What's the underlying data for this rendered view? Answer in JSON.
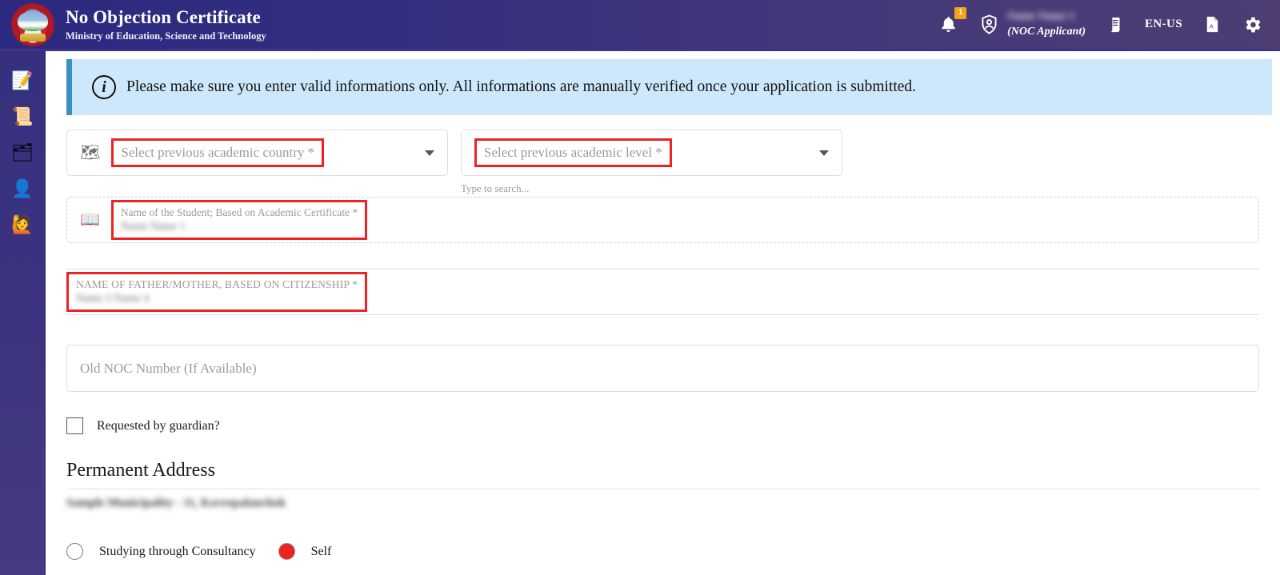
{
  "header": {
    "emblem_name": "nepal-government-emblem",
    "title": "No Objection Certificate",
    "subtitle": "Ministry of Education, Science and Technology",
    "notification_badge": "1",
    "user_name": "Name Name 1",
    "user_role": "(NOC Applicant)",
    "language": "EN-US",
    "icons": {
      "bell": "🔔",
      "shield_user": "⛨",
      "document": "📜",
      "pdf": "📑",
      "gear": "⚙"
    }
  },
  "sidebar": {
    "items": [
      {
        "name": "new-application",
        "icon": "📝"
      },
      {
        "name": "certificates",
        "icon": "📜"
      },
      {
        "name": "documents",
        "icon": "🗂"
      },
      {
        "name": "profile",
        "icon": "👤"
      },
      {
        "name": "help",
        "icon": "🙋"
      }
    ]
  },
  "alert": {
    "icon": "i",
    "message": "Please make sure you enter valid informations only. All informations are manually verified once your application is submitted."
  },
  "form": {
    "country": {
      "icon": "🗺",
      "placeholder": "Select previous academic country *"
    },
    "level": {
      "placeholder": "Select previous academic level *",
      "helper": "Type to search..."
    },
    "student_name": {
      "icon": "📖",
      "label": "Name of the Student; Based on Academic Certificate *",
      "value": "Name Name 1"
    },
    "parent_name": {
      "label": "NAME OF FATHER/MOTHER, BASED ON CITIZENSHIP *",
      "value": "Name 3 Name 4"
    },
    "old_noc": {
      "placeholder": "Old NOC Number (If Available)"
    },
    "guardian_checkbox": {
      "label": "Requested by guardian?",
      "checked": false
    },
    "permanent_address": {
      "title": "Permanent Address",
      "value": "Sample Municipality - 11, Kavrepalanchok"
    },
    "study_mode": {
      "options": [
        {
          "label": "Studying through Consultancy",
          "selected": false
        },
        {
          "label": "Self",
          "selected": true
        }
      ]
    }
  },
  "colors": {
    "header_left": "#2b2a80",
    "header_right": "#4d3d73",
    "sidebar": "#3b3380",
    "alert_bg": "#cde8fa",
    "alert_accent": "#3a8fc4",
    "highlight_red": "#ee2222",
    "radio_selected": "#f02121",
    "badge_orange": "#f5a21a"
  }
}
